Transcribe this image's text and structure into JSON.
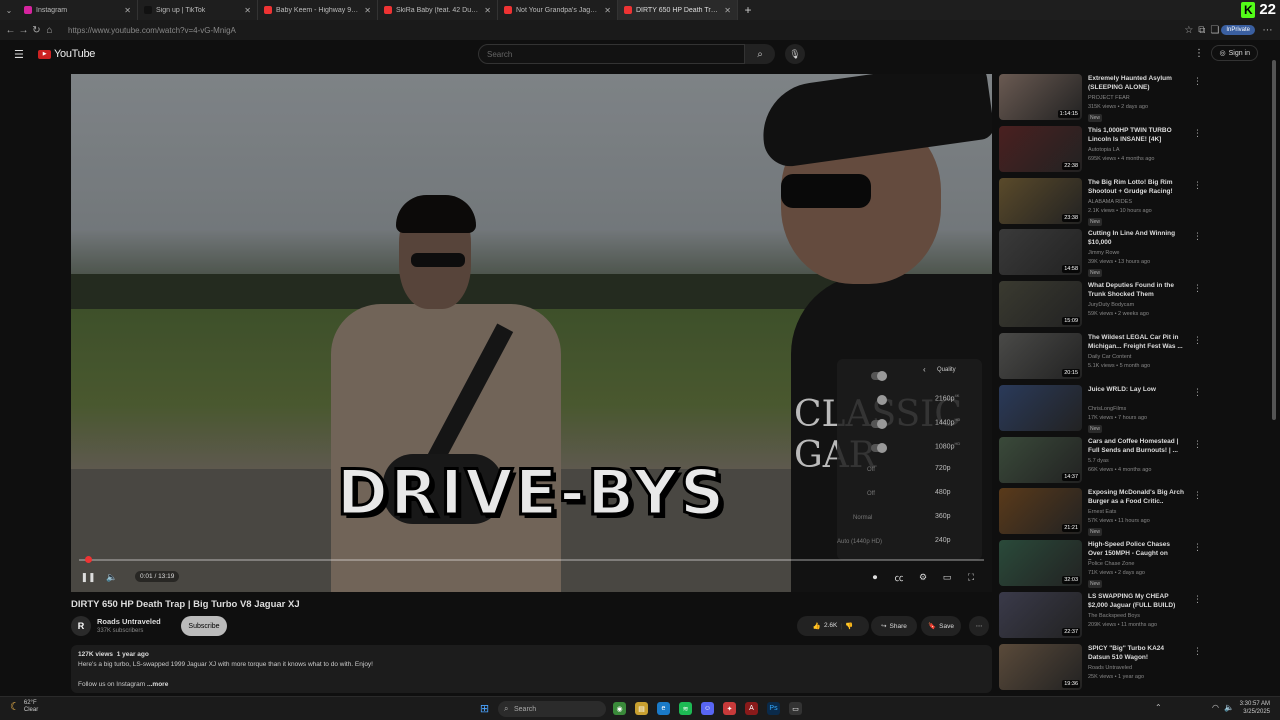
{
  "browser": {
    "tabs": [
      {
        "title": "Instagram",
        "color": "#d6249f"
      },
      {
        "title": "Sign up | TikTok",
        "color": "#111111"
      },
      {
        "title": "Baby Keem - Highway 95 pt. 2 (Of",
        "color": "#e33"
      },
      {
        "title": "SkiRa Baby (feat. 42 Dugg) - West",
        "color": "#e33"
      },
      {
        "title": "Not Your Grandpa's Jaguar: Custom",
        "color": "#e33"
      },
      {
        "title": "DIRTY 650 HP Death Trap | Big",
        "color": "#e33"
      }
    ],
    "kick_count": "22",
    "url": "https://www.youtube.com/watch?v=4-vG-MnigA",
    "inprivate": "InPrivate"
  },
  "youtube": {
    "logo_text": "YouTube",
    "search_placeholder": "Search",
    "sign_in": "Sign in"
  },
  "video": {
    "overlay_text": "DRIVE-BYS",
    "shirt_text": "CLASSIC GAR",
    "time": "0:01 / 13:19",
    "quality_menu": {
      "header": "Quality",
      "options": [
        {
          "label": "2160p",
          "sup": "4K"
        },
        {
          "label": "1440p",
          "sup": "HD"
        },
        {
          "label": "1080p",
          "sup": "HD"
        },
        {
          "label": "720p",
          "sup": ""
        },
        {
          "label": "480p",
          "sup": ""
        },
        {
          "label": "360p",
          "sup": ""
        },
        {
          "label": "240p",
          "sup": ""
        }
      ],
      "left_values": [
        "Off",
        "Off",
        "Normal",
        "Auto (1440p HD)"
      ]
    },
    "title": "DIRTY 650 HP Death Trap | Big Turbo V8 Jaguar XJ",
    "channel": "Roads Untraveled",
    "channel_initial": "R",
    "subscribers": "337K subscribers",
    "subscribe": "Subscribe",
    "likes": "2.6K",
    "share": "Share",
    "save": "Save",
    "views": "127K views",
    "age": "1 year ago",
    "desc_line1": "Here's a big turbo, LS-swapped 1999 Jaguar XJ with more torque than it knows what to do with. Enjoy!",
    "desc_line2": "Follow us on Instagram",
    "more": "...more"
  },
  "sidebar": [
    {
      "title": "Extremely Haunted Asylum (SLEEPING ALONE)",
      "channel": "PROJECT FEAR",
      "meta": "315K views • 2 days ago",
      "new": "New",
      "dur": "1:14:15",
      "color": "#6a5a52"
    },
    {
      "title": "This 1,000HP TWIN TURBO Lincoln Is INSANE! [4K]",
      "channel": "Autotopia LA",
      "meta": "695K views • 4 months ago",
      "new": "",
      "dur": "22:38",
      "color": "#4a2020"
    },
    {
      "title": "The Big Rim Lotto! Big Rim Shootout + Grudge Racing!",
      "channel": "ALABAMA RIDES",
      "meta": "2.1K views • 10 hours ago",
      "new": "New",
      "dur": "23:38",
      "color": "#5a4a2a"
    },
    {
      "title": "Cutting In Line And Winning $10,000",
      "channel": "Jimmy Rowe",
      "meta": "39K views • 13 hours ago",
      "new": "New",
      "dur": "14:58",
      "color": "#3a3a3a"
    },
    {
      "title": "What Deputies Found in the Trunk Shocked Them",
      "channel": "JuryDuty Bodycam",
      "meta": "59K views • 2 weeks ago",
      "new": "",
      "dur": "15:09",
      "color": "#3a3a30"
    },
    {
      "title": "The Wildest LEGAL Car Pit in Michigan... Freight Fest Was ...",
      "channel": "Daily Car Content",
      "meta": "5.1K views • 5 month ago",
      "new": "",
      "dur": "20:15",
      "color": "#4a4a48"
    },
    {
      "title": "Juice WRLD: Lay Low",
      "channel": "ChrisLongFilms",
      "meta": "17K views • 7 hours ago",
      "new": "New",
      "dur": "",
      "color": "#2a3a5a"
    },
    {
      "title": "Cars and Coffee Homestead | Full Sends and Burnouts! | ...",
      "channel": "5.7 dyas",
      "meta": "66K views • 4 months ago",
      "new": "",
      "dur": "14:37",
      "color": "#3a4a3a"
    },
    {
      "title": "Exposing McDonald's Big Arch Burger as a Food Critic..",
      "channel": "Ernest Eats",
      "meta": "57K views • 11 hours ago",
      "new": "New",
      "dur": "21:21",
      "color": "#5a3a1a"
    },
    {
      "title": "High-Speed Police Chases Over 150MPH - Caught on Dashcam",
      "channel": "Police Chase Zone",
      "meta": "71K views • 2 days ago",
      "new": "New",
      "dur": "32:03",
      "color": "#2a4a3a"
    },
    {
      "title": "LS SWAPPING My CHEAP $2,000 Jaguar (FULL BUILD)",
      "channel": "The Backspeed Boys",
      "meta": "209K views • 11 months ago",
      "new": "",
      "dur": "22:37",
      "color": "#3a3a4a"
    },
    {
      "title": "SPICY \"Big\" Turbo KA24 Datsun 510 Wagon!",
      "channel": "Roads Untraveled",
      "meta": "25K views • 1 year ago",
      "new": "",
      "dur": "19:36",
      "color": "#5a4a3a"
    }
  ],
  "taskbar": {
    "temp": "62°F",
    "weather": "Clear",
    "search": "Search",
    "time": "3:30:57 AM",
    "date": "3/25/2025"
  }
}
